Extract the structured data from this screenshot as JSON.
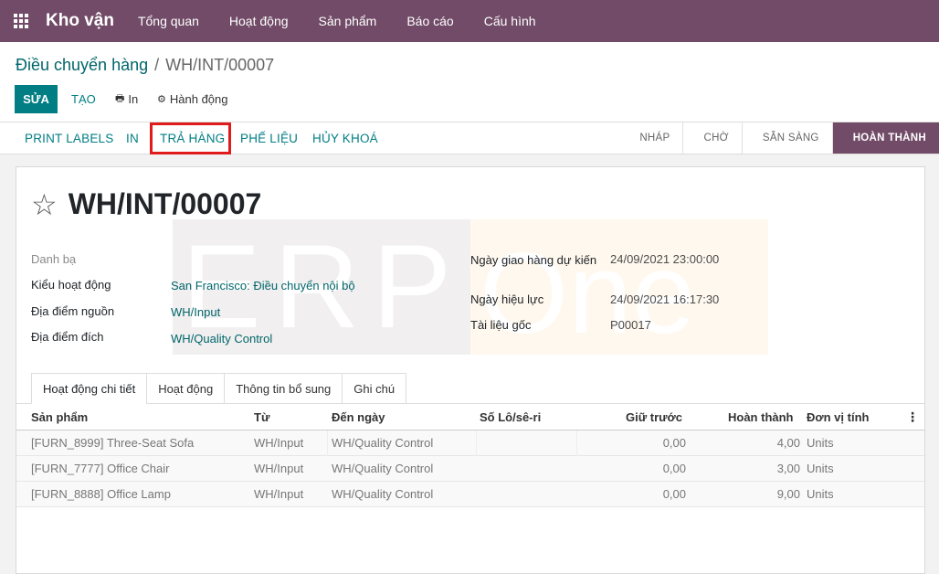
{
  "app": {
    "brand": "Kho vận",
    "menu": [
      "Tổng quan",
      "Hoạt động",
      "Sản phẩm",
      "Báo cáo",
      "Cấu hình"
    ]
  },
  "breadcrumb": {
    "parent": "Điều chuyển hàng",
    "separator": "/",
    "current": "WH/INT/00007"
  },
  "toolbar": {
    "edit": "SỬA",
    "create": "TẠO",
    "print": "In",
    "actions": "Hành động"
  },
  "statusbar": {
    "buttons": [
      "PRINT LABELS",
      "IN",
      "TRẢ HÀNG",
      "PHẾ LIỆU",
      "HỦY KHOÁ"
    ],
    "stages": [
      "NHÁP",
      "CHỜ",
      "SẴN SÀNG",
      "HOÀN THÀNH"
    ],
    "active_stage": "HOÀN THÀNH"
  },
  "record": {
    "title": "WH/INT/00007",
    "fields_left": [
      {
        "label": "Danh bạ",
        "value": ""
      },
      {
        "label": "Kiểu hoạt động",
        "value": "San Francisco: Điều chuyển nội bộ"
      },
      {
        "label": "Địa điểm nguồn",
        "value": "WH/Input"
      },
      {
        "label": "Địa điểm đích",
        "value": "WH/Quality Control"
      }
    ],
    "fields_right": [
      {
        "label": "Ngày giao hàng dự kiến",
        "value": "24/09/2021 23:00:00"
      },
      {
        "label": "Ngày hiệu lực",
        "value": "24/09/2021 16:17:30"
      },
      {
        "label": "Tài liệu gốc",
        "value": "P00017"
      }
    ]
  },
  "watermark": {
    "left": "ERP",
    "right": "One"
  },
  "tabs": [
    "Hoạt động chi tiết",
    "Hoạt động",
    "Thông tin bổ sung",
    "Ghi chú"
  ],
  "table": {
    "columns": [
      "Sản phẩm",
      "Từ",
      "Đến ngày",
      "Số Lô/sê-ri",
      "Giữ trước",
      "Hoàn thành",
      "Đơn vị tính"
    ],
    "rows": [
      {
        "product": "[FURN_8999] Three-Seat Sofa",
        "from": "WH/Input",
        "to": "WH/Quality Control",
        "lot": "",
        "reserved": "0,00",
        "done": "4,00",
        "uom": "Units"
      },
      {
        "product": "[FURN_7777] Office Chair",
        "from": "WH/Input",
        "to": "WH/Quality Control",
        "lot": "",
        "reserved": "0,00",
        "done": "3,00",
        "uom": "Units"
      },
      {
        "product": "[FURN_8888] Office Lamp",
        "from": "WH/Input",
        "to": "WH/Quality Control",
        "lot": "",
        "reserved": "0,00",
        "done": "9,00",
        "uom": "Units"
      }
    ]
  },
  "colors": {
    "brand": "#714b67",
    "accent": "#017e84",
    "highlight": "#e01b1b"
  }
}
